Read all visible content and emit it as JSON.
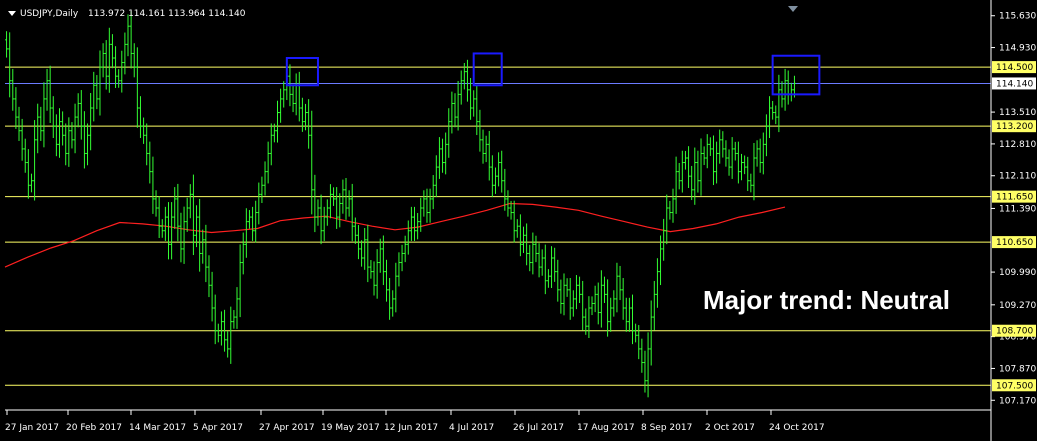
{
  "header": {
    "symbol": "USDJPY,Daily",
    "ohlc": "113.972 114.161 113.964 114.140"
  },
  "annotation": "Major trend: Neutral",
  "colors": {
    "background": "#000000",
    "candle": "#33ff33",
    "ma": "#ff2020",
    "level": "#ffff66",
    "price_line": "#6b7bff",
    "box": "#1a1aff"
  },
  "chart_data": {
    "type": "candlestick",
    "x_ticks": [
      "27 Jan 2017",
      "20 Feb 2017",
      "14 Mar 2017",
      "5 Apr 2017",
      "27 Apr 2017",
      "19 May 2017",
      "12 Jun 2017",
      "4 Jul 2017",
      "26 Jul 2017",
      "17 Aug 2017",
      "8 Sep 2017",
      "2 Oct 2017",
      "24 Oct 2017"
    ],
    "y_ticks": [
      "115.630",
      "114.930",
      "113.510",
      "112.810",
      "112.110",
      "111.390",
      "109.990",
      "109.270",
      "108.570",
      "107.870",
      "107.170"
    ],
    "ylim": [
      107.0,
      115.8
    ],
    "levels": [
      {
        "label": "114.500",
        "value": 114.5
      },
      {
        "label": "113.200",
        "value": 113.2
      },
      {
        "label": "111.650",
        "value": 111.65
      },
      {
        "label": "110.650",
        "value": 110.65
      },
      {
        "label": "108.700",
        "value": 108.7
      },
      {
        "label": "107.500",
        "value": 107.5
      }
    ],
    "current_price": {
      "label": "114.140",
      "value": 114.14
    },
    "boxes": [
      {
        "x0": 90,
        "x1": 100,
        "y0": 114.1,
        "y1": 114.7
      },
      {
        "x0": 150,
        "x1": 159,
        "y0": 114.1,
        "y1": 114.8
      },
      {
        "x0": 246,
        "x1": 261,
        "y0": 113.9,
        "y1": 114.75
      }
    ],
    "close": [
      114.9,
      114.2,
      113.8,
      113.4,
      113.1,
      112.7,
      112.4,
      111.9,
      112.0,
      112.9,
      113.4,
      113.1,
      113.8,
      114.2,
      113.6,
      113.2,
      112.8,
      113.3,
      113.0,
      112.6,
      113.1,
      112.9,
      113.4,
      113.7,
      113.2,
      112.6,
      113.0,
      113.6,
      114.1,
      113.8,
      114.5,
      114.8,
      114.3,
      115.0,
      114.7,
      114.3,
      114.2,
      114.6,
      115.0,
      115.4,
      114.8,
      114.5,
      113.6,
      113.2,
      113.0,
      112.6,
      112.2,
      111.6,
      111.4,
      111.0,
      110.9,
      111.2,
      110.6,
      111.2,
      111.6,
      111.0,
      110.5,
      111.1,
      111.4,
      111.7,
      110.8,
      111.2,
      110.4,
      110.7,
      110.1,
      109.7,
      109.2,
      108.7,
      108.6,
      108.9,
      108.5,
      108.3,
      108.9,
      109.0,
      109.4,
      110.2,
      110.6,
      111.1,
      111.2,
      110.9,
      111.3,
      111.7,
      111.9,
      112.2,
      112.6,
      113.0,
      113.1,
      113.5,
      113.8,
      114.0,
      114.3,
      113.9,
      113.7,
      114.1,
      113.6,
      113.3,
      113.5,
      113.0,
      111.8,
      111.2,
      111.4,
      110.9,
      111.2,
      111.4,
      111.7,
      111.6,
      111.2,
      111.5,
      111.8,
      111.4,
      111.6,
      111.0,
      110.8,
      110.5,
      110.3,
      110.7,
      110.1,
      110.0,
      109.7,
      110.2,
      110.5,
      110.0,
      109.6,
      109.2,
      109.4,
      109.9,
      110.2,
      110.4,
      110.6,
      110.9,
      111.2,
      110.9,
      111.1,
      111.4,
      111.6,
      111.3,
      111.6,
      111.9,
      112.3,
      112.7,
      112.4,
      112.8,
      113.3,
      113.7,
      113.4,
      113.9,
      114.2,
      114.4,
      114.0,
      113.6,
      113.8,
      113.3,
      112.9,
      112.6,
      112.8,
      112.3,
      111.9,
      112.1,
      112.4,
      112.0,
      111.6,
      111.4,
      111.3,
      110.9,
      111.0,
      110.6,
      110.8,
      110.4,
      110.2,
      110.6,
      110.4,
      110.1,
      110.3,
      109.8,
      109.9,
      110.3,
      110.0,
      109.6,
      109.3,
      109.7,
      109.6,
      109.2,
      109.4,
      109.7,
      109.5,
      109.0,
      108.8,
      109.2,
      109.3,
      109.5,
      109.1,
      109.7,
      109.5,
      108.9,
      109.2,
      109.4,
      109.9,
      109.6,
      109.2,
      108.9,
      109.2,
      108.7,
      108.6,
      108.3,
      108.0,
      107.6,
      108.3,
      109.0,
      109.5,
      110.0,
      110.5,
      110.9,
      111.4,
      111.3,
      111.6,
      112.2,
      112.0,
      112.4,
      112.5,
      112.1,
      111.8,
      112.4,
      112.0,
      112.6,
      112.5,
      112.8,
      112.7,
      112.2,
      112.6,
      112.9,
      112.7,
      112.5,
      112.3,
      112.7,
      112.6,
      112.2,
      112.4,
      112.3,
      112.0,
      111.9,
      112.5,
      112.7,
      112.4,
      112.8,
      113.2,
      113.6,
      113.5,
      113.4,
      114.0,
      113.8,
      114.2,
      113.9,
      114.0,
      114.14
    ],
    "ma": [
      110.1,
      110.32,
      110.52,
      110.68,
      110.9,
      111.08,
      111.05,
      111.0,
      110.92,
      110.86,
      110.9,
      110.95,
      111.12,
      111.18,
      111.22,
      111.1,
      111.0,
      110.92,
      110.98,
      111.1,
      111.22,
      111.35,
      111.5,
      111.48,
      111.42,
      111.35,
      111.22,
      111.1,
      110.98,
      110.88,
      110.95,
      111.05,
      111.2,
      111.3,
      111.42
    ]
  }
}
